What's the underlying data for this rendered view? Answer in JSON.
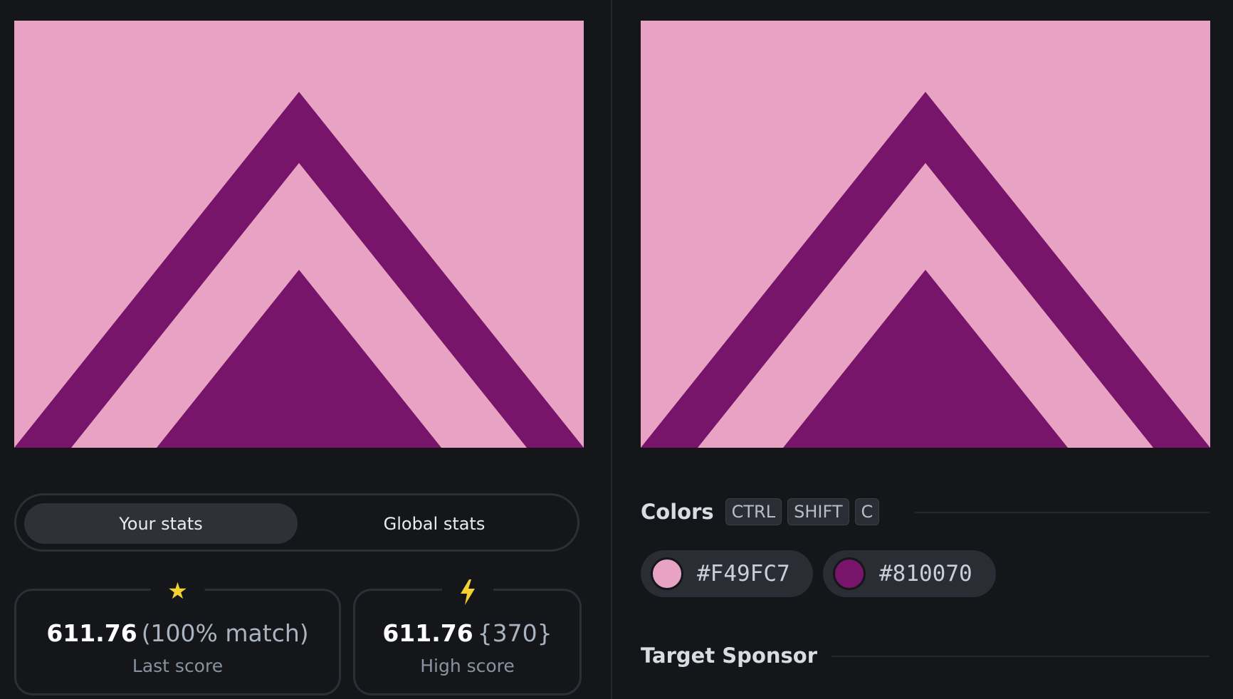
{
  "canvases": {
    "background_color": "#E8A3C4",
    "shape_color": "#78156A",
    "shape": "two stacked chevron/triangle shapes (outer chevron outline, inner solid triangle)"
  },
  "stats_toggle": {
    "your_stats": "Your stats",
    "global_stats": "Global stats",
    "active": "your_stats"
  },
  "last_score": {
    "icon": "star-icon",
    "value": "611.76",
    "extra": "(100% match)",
    "label": "Last score"
  },
  "high_score": {
    "icon": "lightning-icon",
    "value": "611.76",
    "extra": "{370}",
    "label": "High score"
  },
  "colors": {
    "title": "Colors",
    "shortcut_keys": [
      "CTRL",
      "SHIFT",
      "C"
    ],
    "swatches": [
      {
        "hex": "#F49FC7",
        "color": "#E8A3C4"
      },
      {
        "hex": "#810070",
        "color": "#78156A"
      }
    ]
  },
  "sponsor": {
    "title": "Target Sponsor"
  }
}
